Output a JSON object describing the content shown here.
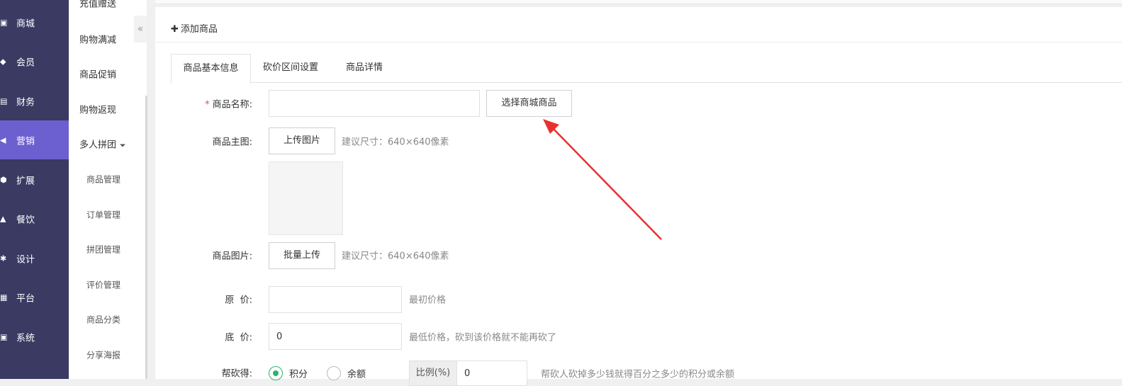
{
  "sidebar": {
    "items": [
      {
        "icon": "shopping-bag-icon",
        "glyph": "▣",
        "label": "商城"
      },
      {
        "icon": "tag-icon",
        "glyph": "◆",
        "label": "会员"
      },
      {
        "icon": "ledger-icon",
        "glyph": "▤",
        "label": "财务"
      },
      {
        "icon": "megaphone-icon",
        "glyph": "◀",
        "label": "营销"
      },
      {
        "icon": "cube-icon",
        "glyph": "⬢",
        "label": "扩展"
      },
      {
        "icon": "dish-icon",
        "glyph": "▲",
        "label": "餐饮"
      },
      {
        "icon": "puzzle-icon",
        "glyph": "✱",
        "label": "设计"
      },
      {
        "icon": "grid-icon",
        "glyph": "▦",
        "label": "平台"
      },
      {
        "icon": "monitor-icon",
        "glyph": "▣",
        "label": "系统"
      }
    ],
    "active_index": 3
  },
  "submenu": {
    "partial_top": "充值赠送",
    "items": [
      "购物满减",
      "商品促销",
      "购物返现"
    ],
    "group": "多人拼团",
    "children": [
      "商品管理",
      "订单管理",
      "拼团管理",
      "评价管理",
      "商品分类",
      "分享海报"
    ],
    "collapse_glyph": "«"
  },
  "page": {
    "plus": "✚",
    "title": "添加商品"
  },
  "tabs": [
    {
      "label": "商品基本信息",
      "active": true
    },
    {
      "label": "砍价区间设置",
      "active": false
    },
    {
      "label": "商品详情",
      "active": false
    }
  ],
  "form": {
    "name": {
      "required_mark": "*",
      "label": "商品名称:",
      "value": "",
      "select_button": "选择商城商品"
    },
    "main_image": {
      "label": "商品主图:",
      "upload_button": "上传图片",
      "hint": "建议尺寸：640×640像素"
    },
    "images": {
      "label": "商品图片:",
      "upload_button": "批量上传",
      "hint": "建议尺寸：640×640像素"
    },
    "original_price": {
      "label": "原  价:",
      "value": "",
      "hint": "最初价格"
    },
    "floor_price": {
      "label": "底  价:",
      "value": "0",
      "hint": "最低价格，砍到该价格就不能再砍了"
    },
    "reward": {
      "label": "帮砍得:",
      "options": [
        {
          "label": "积分",
          "checked": true
        },
        {
          "label": "余额",
          "checked": false
        }
      ],
      "ratio_label": "比例(%)",
      "ratio_value": "0",
      "hint": "帮砍人砍掉多少钱就得百分之多少的积分或余额"
    }
  },
  "annotation": {
    "color": "#e8312f"
  }
}
